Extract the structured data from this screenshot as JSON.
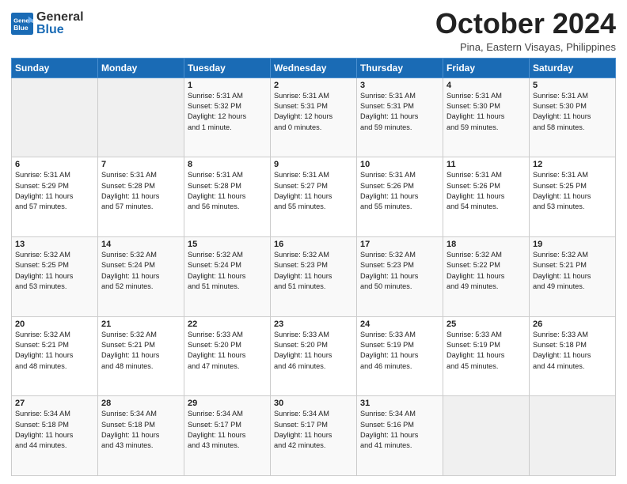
{
  "header": {
    "logo_general": "General",
    "logo_blue": "Blue",
    "month_title": "October 2024",
    "location": "Pina, Eastern Visayas, Philippines"
  },
  "days_of_week": [
    "Sunday",
    "Monday",
    "Tuesday",
    "Wednesday",
    "Thursday",
    "Friday",
    "Saturday"
  ],
  "weeks": [
    [
      {
        "day": "",
        "info": ""
      },
      {
        "day": "",
        "info": ""
      },
      {
        "day": "1",
        "info": "Sunrise: 5:31 AM\nSunset: 5:32 PM\nDaylight: 12 hours\nand 1 minute."
      },
      {
        "day": "2",
        "info": "Sunrise: 5:31 AM\nSunset: 5:31 PM\nDaylight: 12 hours\nand 0 minutes."
      },
      {
        "day": "3",
        "info": "Sunrise: 5:31 AM\nSunset: 5:31 PM\nDaylight: 11 hours\nand 59 minutes."
      },
      {
        "day": "4",
        "info": "Sunrise: 5:31 AM\nSunset: 5:30 PM\nDaylight: 11 hours\nand 59 minutes."
      },
      {
        "day": "5",
        "info": "Sunrise: 5:31 AM\nSunset: 5:30 PM\nDaylight: 11 hours\nand 58 minutes."
      }
    ],
    [
      {
        "day": "6",
        "info": "Sunrise: 5:31 AM\nSunset: 5:29 PM\nDaylight: 11 hours\nand 57 minutes."
      },
      {
        "day": "7",
        "info": "Sunrise: 5:31 AM\nSunset: 5:28 PM\nDaylight: 11 hours\nand 57 minutes."
      },
      {
        "day": "8",
        "info": "Sunrise: 5:31 AM\nSunset: 5:28 PM\nDaylight: 11 hours\nand 56 minutes."
      },
      {
        "day": "9",
        "info": "Sunrise: 5:31 AM\nSunset: 5:27 PM\nDaylight: 11 hours\nand 55 minutes."
      },
      {
        "day": "10",
        "info": "Sunrise: 5:31 AM\nSunset: 5:26 PM\nDaylight: 11 hours\nand 55 minutes."
      },
      {
        "day": "11",
        "info": "Sunrise: 5:31 AM\nSunset: 5:26 PM\nDaylight: 11 hours\nand 54 minutes."
      },
      {
        "day": "12",
        "info": "Sunrise: 5:31 AM\nSunset: 5:25 PM\nDaylight: 11 hours\nand 53 minutes."
      }
    ],
    [
      {
        "day": "13",
        "info": "Sunrise: 5:32 AM\nSunset: 5:25 PM\nDaylight: 11 hours\nand 53 minutes."
      },
      {
        "day": "14",
        "info": "Sunrise: 5:32 AM\nSunset: 5:24 PM\nDaylight: 11 hours\nand 52 minutes."
      },
      {
        "day": "15",
        "info": "Sunrise: 5:32 AM\nSunset: 5:24 PM\nDaylight: 11 hours\nand 51 minutes."
      },
      {
        "day": "16",
        "info": "Sunrise: 5:32 AM\nSunset: 5:23 PM\nDaylight: 11 hours\nand 51 minutes."
      },
      {
        "day": "17",
        "info": "Sunrise: 5:32 AM\nSunset: 5:23 PM\nDaylight: 11 hours\nand 50 minutes."
      },
      {
        "day": "18",
        "info": "Sunrise: 5:32 AM\nSunset: 5:22 PM\nDaylight: 11 hours\nand 49 minutes."
      },
      {
        "day": "19",
        "info": "Sunrise: 5:32 AM\nSunset: 5:21 PM\nDaylight: 11 hours\nand 49 minutes."
      }
    ],
    [
      {
        "day": "20",
        "info": "Sunrise: 5:32 AM\nSunset: 5:21 PM\nDaylight: 11 hours\nand 48 minutes."
      },
      {
        "day": "21",
        "info": "Sunrise: 5:32 AM\nSunset: 5:21 PM\nDaylight: 11 hours\nand 48 minutes."
      },
      {
        "day": "22",
        "info": "Sunrise: 5:33 AM\nSunset: 5:20 PM\nDaylight: 11 hours\nand 47 minutes."
      },
      {
        "day": "23",
        "info": "Sunrise: 5:33 AM\nSunset: 5:20 PM\nDaylight: 11 hours\nand 46 minutes."
      },
      {
        "day": "24",
        "info": "Sunrise: 5:33 AM\nSunset: 5:19 PM\nDaylight: 11 hours\nand 46 minutes."
      },
      {
        "day": "25",
        "info": "Sunrise: 5:33 AM\nSunset: 5:19 PM\nDaylight: 11 hours\nand 45 minutes."
      },
      {
        "day": "26",
        "info": "Sunrise: 5:33 AM\nSunset: 5:18 PM\nDaylight: 11 hours\nand 44 minutes."
      }
    ],
    [
      {
        "day": "27",
        "info": "Sunrise: 5:34 AM\nSunset: 5:18 PM\nDaylight: 11 hours\nand 44 minutes."
      },
      {
        "day": "28",
        "info": "Sunrise: 5:34 AM\nSunset: 5:18 PM\nDaylight: 11 hours\nand 43 minutes."
      },
      {
        "day": "29",
        "info": "Sunrise: 5:34 AM\nSunset: 5:17 PM\nDaylight: 11 hours\nand 43 minutes."
      },
      {
        "day": "30",
        "info": "Sunrise: 5:34 AM\nSunset: 5:17 PM\nDaylight: 11 hours\nand 42 minutes."
      },
      {
        "day": "31",
        "info": "Sunrise: 5:34 AM\nSunset: 5:16 PM\nDaylight: 11 hours\nand 41 minutes."
      },
      {
        "day": "",
        "info": ""
      },
      {
        "day": "",
        "info": ""
      }
    ]
  ]
}
